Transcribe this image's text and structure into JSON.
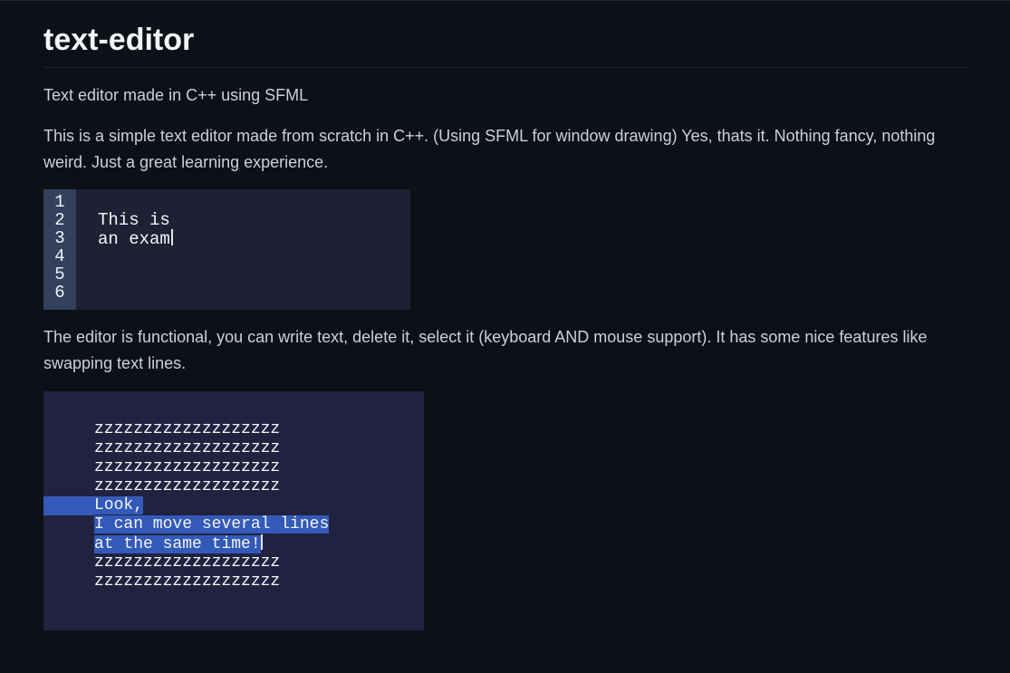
{
  "title": "text-editor",
  "subtitle": "Text editor made in C++ using SFML",
  "intro": "This is a simple text editor made from scratch in C++. (Using SFML for window drawing) Yes, thats it. Nothing fancy, nothing weird. Just a great learning experience.",
  "features_paragraph": "The editor is functional, you can write text, delete it, select it (keyboard AND mouse support). It has some nice features like swapping text lines.",
  "editor1": {
    "line_numbers": [
      "1",
      "2",
      "3",
      "4",
      "5",
      "6"
    ],
    "lines": [
      "",
      "This is",
      "an exam"
    ]
  },
  "editor2": {
    "lines": [
      {
        "text": "zzzzzzzzzzzzzzzzzzz",
        "sel": false
      },
      {
        "text": "zzzzzzzzzzzzzzzzzzz",
        "sel": false
      },
      {
        "text": "zzzzzzzzzzzzzzzzzzz",
        "sel": false
      },
      {
        "text": "zzzzzzzzzzzzzzzzzzz",
        "sel": false
      },
      {
        "text": "Look,",
        "sel": "first"
      },
      {
        "text": "I can move several lines",
        "sel": true
      },
      {
        "text": "at the same time!",
        "sel": "caret"
      },
      {
        "text": "zzzzzzzzzzzzzzzzzzz",
        "sel": false
      },
      {
        "text": "zzzzzzzzzzzzzzzzzzz",
        "sel": false
      }
    ]
  }
}
